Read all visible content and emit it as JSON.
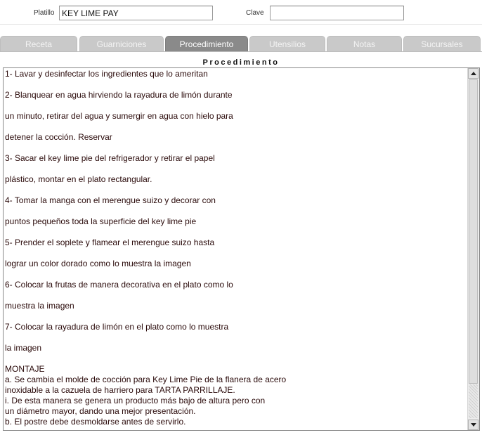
{
  "form": {
    "platillo_label": "Platillo",
    "platillo_value": "KEY LIME PAY",
    "clave_label": "Clave",
    "clave_value": ""
  },
  "tabs": [
    {
      "label": "Receta",
      "active": false
    },
    {
      "label": "Guarniciones",
      "active": false
    },
    {
      "label": "Procedimiento",
      "active": true
    },
    {
      "label": "Utensilios",
      "active": false
    },
    {
      "label": "Notas",
      "active": false
    },
    {
      "label": "Sucursales",
      "active": false
    }
  ],
  "section": {
    "title": "Procedimiento"
  },
  "procedure": {
    "steps": [
      "1- Lavar y desinfectar los ingredientes que lo ameritan",
      "2- Blanquear en agua hirviendo la rayadura de limón durante",
      "un minuto, retirar del agua y sumergir en agua con hielo para",
      "detener la cocción. Reservar",
      "3- Sacar el key lime pie del refrigerador y retirar el papel",
      "plástico, montar en el plato rectangular.",
      "4- Tomar la manga con el merengue suizo y decorar con",
      "puntos pequeños toda la superficie del key lime pie",
      "5- Prender el soplete y flamear el merengue suizo hasta",
      "lograr un color dorado como lo muestra la imagen",
      "6- Colocar la frutas de manera decorativa en el plato como lo",
      "muestra la imagen",
      "7- Colocar la rayadura de limón en el plato como lo muestra",
      "la imagen"
    ],
    "montaje": [
      "MONTAJE",
      "a. Se cambia el molde de cocción para Key Lime Pie de la flanera de acero",
      "inoxidable a la cazuela de harriero para TARTA PARRILLAJE.",
      "i. De esta manera se genera un producto más bajo de altura pero con",
      "un diámetro mayor, dando una mejor presentación.",
      "b. El postre debe desmoldarse antes de servirlo."
    ]
  },
  "colors": {
    "tab_inactive": "#c9c9c9",
    "tab_active": "#8a8a8a",
    "text": "#2a0a0a"
  },
  "icons": {
    "scroll_up": "triangle-up-icon",
    "scroll_down": "triangle-down-icon"
  }
}
